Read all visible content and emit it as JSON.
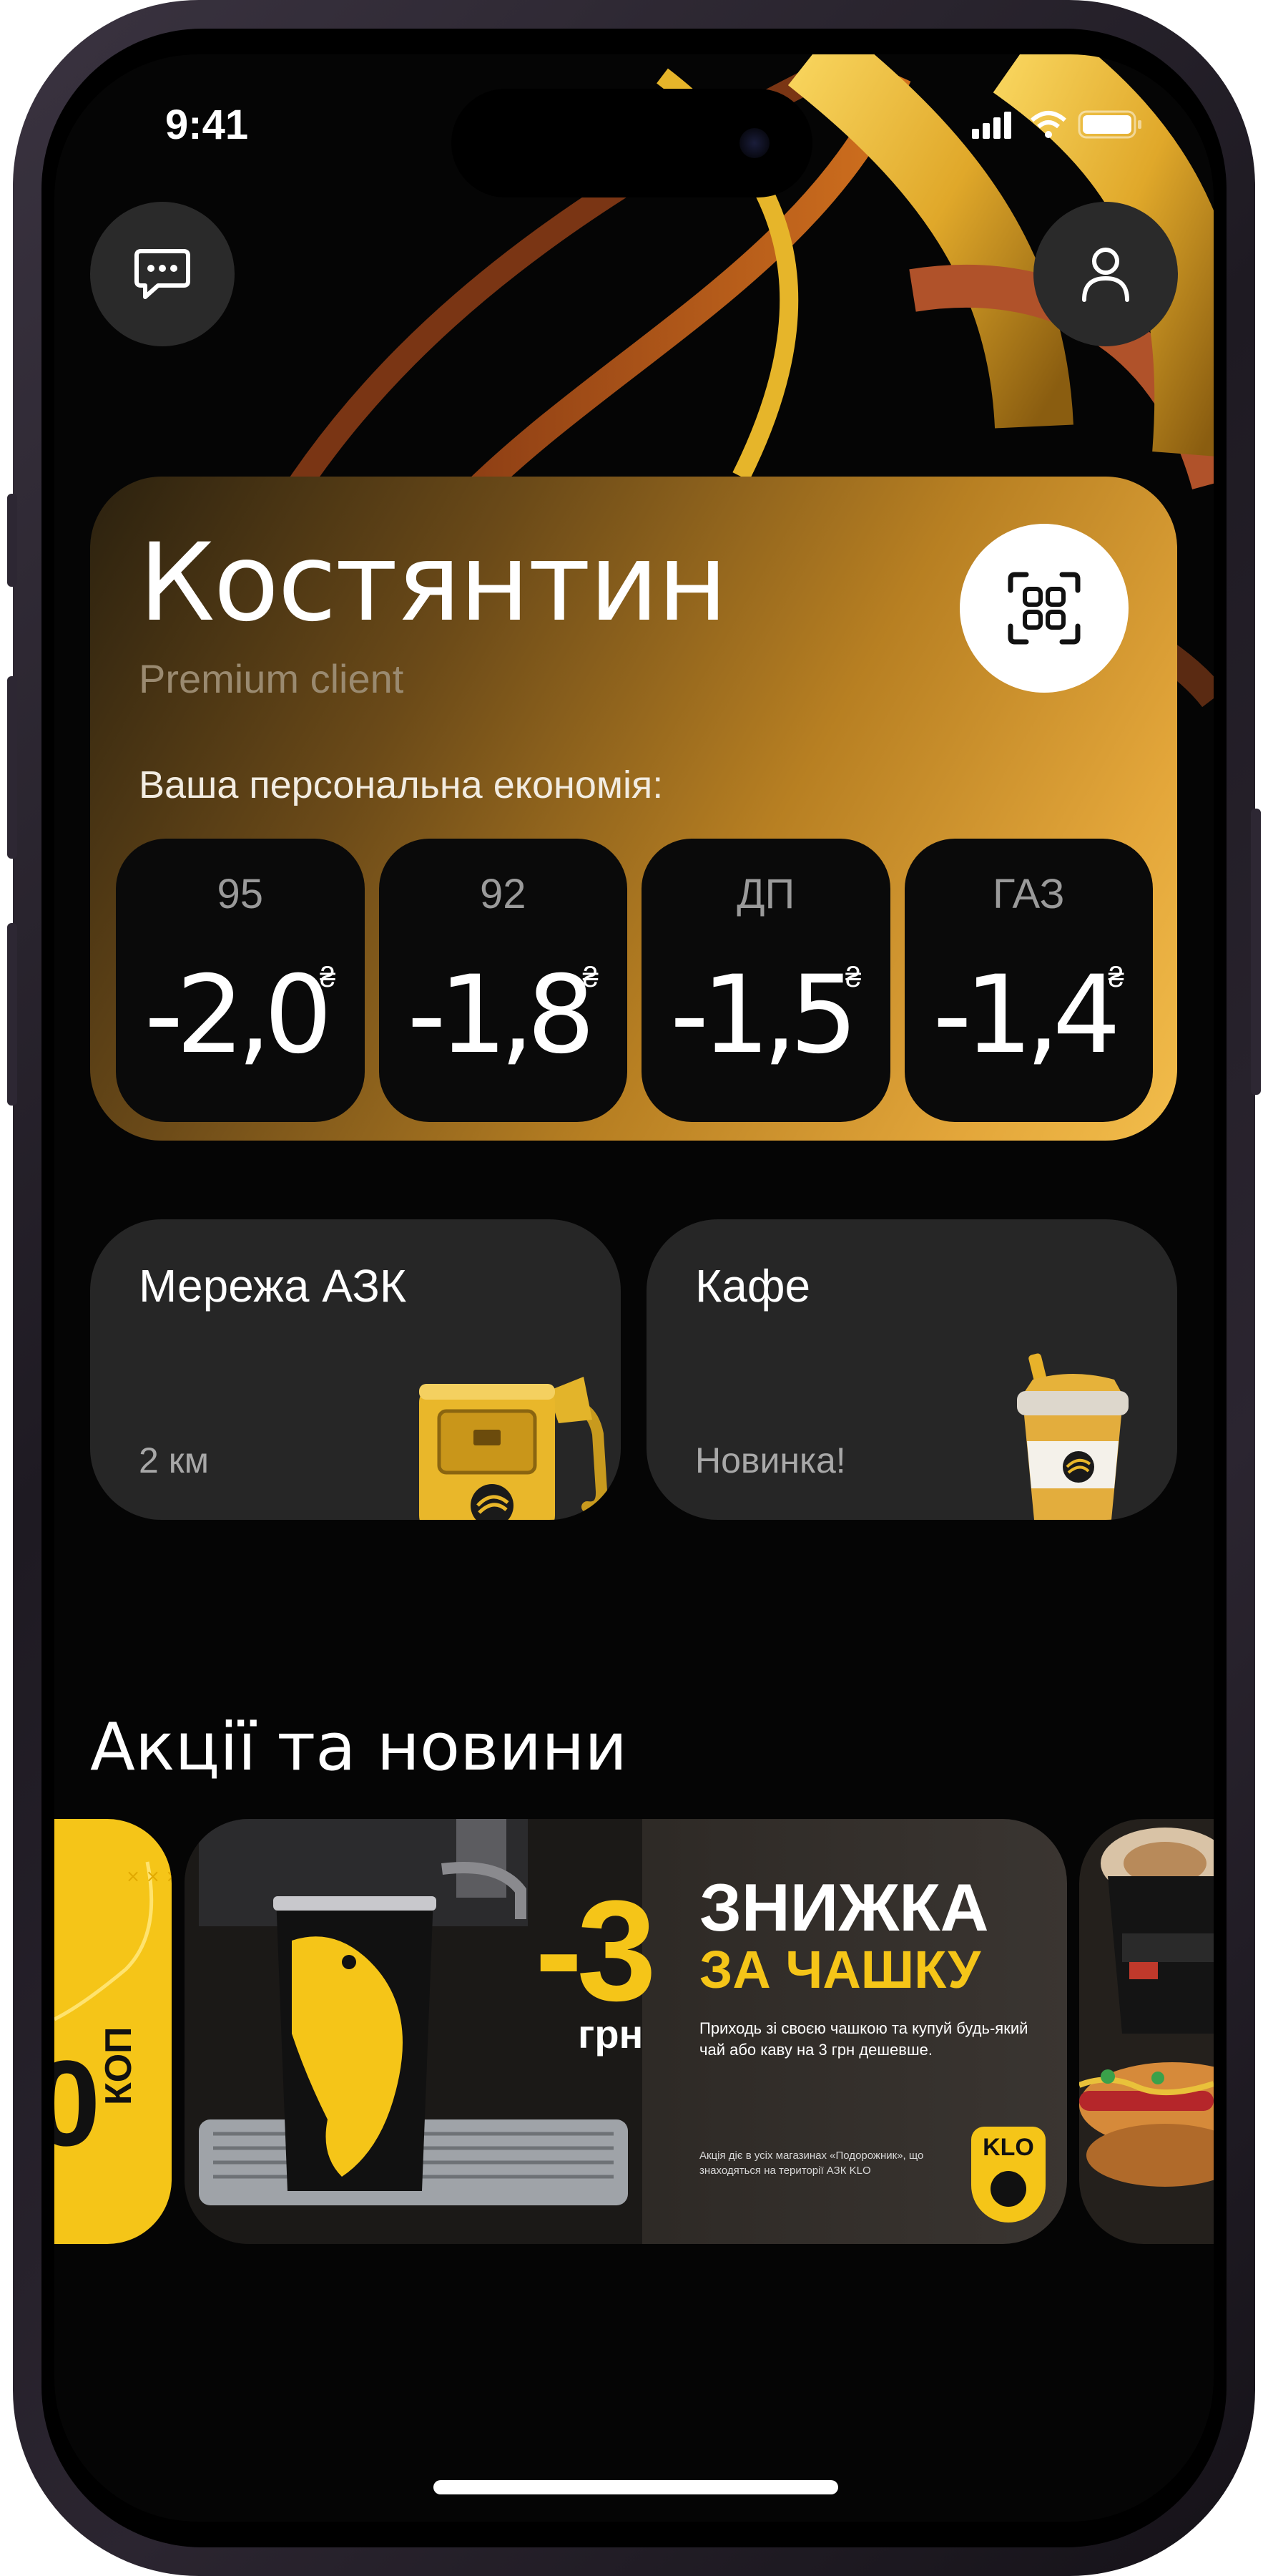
{
  "status_bar": {
    "time": "9:41"
  },
  "header": {
    "chat_icon": "chat-bubble-icon",
    "profile_icon": "user-icon"
  },
  "card": {
    "name": "Костянтин",
    "tier": "Premium client",
    "savings_label": "Ваша персональна економія:",
    "qr_icon": "qr-scan-icon",
    "currency": "₴",
    "fuels": [
      {
        "type": "95",
        "value": "-2,0"
      },
      {
        "type": "92",
        "value": "-1,8"
      },
      {
        "type": "ДП",
        "value": "-1,5"
      },
      {
        "type": "ГАЗ",
        "value": "-1,4"
      }
    ]
  },
  "tiles": [
    {
      "title": "Мережа АЗК",
      "subtitle": "2 км",
      "icon": "fuel-pump-icon"
    },
    {
      "title": "Кафе",
      "subtitle": "Новинка!",
      "icon": "coffee-cup-icon"
    }
  ],
  "news": {
    "title": "Акції та новини",
    "left_banner": {
      "text": "КОП",
      "digit": "0"
    },
    "main_banner": {
      "amount": "-3",
      "unit": "грн",
      "headline1": "ЗНИЖКА",
      "headline2": "ЗА ЧАШКУ",
      "body": "Приходь зі своєю чашкою та купуй будь-який чай або каву на 3 грн дешевше.",
      "footnote": "Акція діє в усіх магазинах «Подорожник», що знаходяться на території АЗК KLO",
      "logo": "KLO"
    }
  },
  "colors": {
    "accent_yellow": "#f5c518",
    "card_dark": "#0a0a0a",
    "tile": "#262626"
  }
}
